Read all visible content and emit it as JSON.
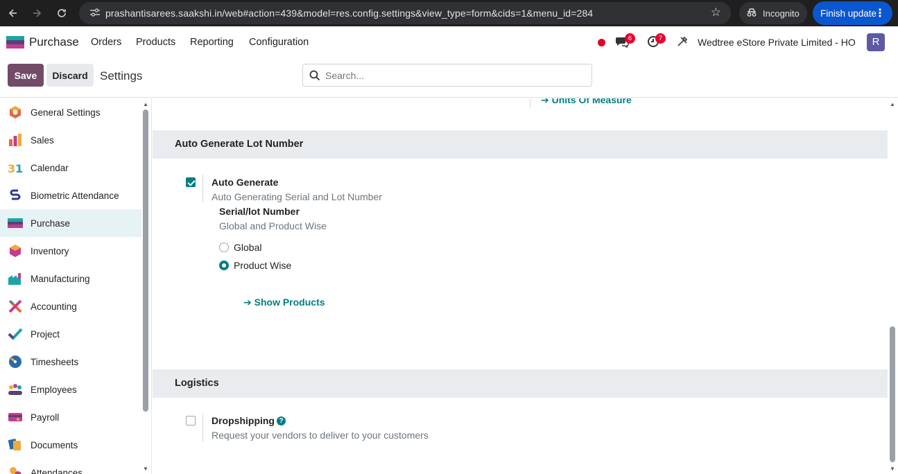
{
  "browser": {
    "url": "prashantisarees.saakshi.in/web#action=439&model=res.config.settings&view_type=form&cids=1&menu_id=284",
    "incognito_label": "Incognito",
    "update_label": "Finish update"
  },
  "navbar": {
    "app_name": "Purchase",
    "menus": [
      "Orders",
      "Products",
      "Reporting",
      "Configuration"
    ],
    "messages_badge": "6",
    "activities_badge": "7",
    "company": "Wedtree eStore Private Limited - HO",
    "avatar_letter": "R"
  },
  "control_panel": {
    "save_label": "Save",
    "discard_label": "Discard",
    "title": "Settings",
    "search_placeholder": "Search..."
  },
  "sidebar": {
    "active": "Purchase",
    "items": [
      {
        "label": "General Settings",
        "icon": "general-settings-icon"
      },
      {
        "label": "Sales",
        "icon": "sales-icon"
      },
      {
        "label": "Calendar",
        "icon": "calendar-icon"
      },
      {
        "label": "Biometric Attendance",
        "icon": "biometric-icon"
      },
      {
        "label": "Purchase",
        "icon": "purchase-icon"
      },
      {
        "label": "Inventory",
        "icon": "inventory-icon"
      },
      {
        "label": "Manufacturing",
        "icon": "manufacturing-icon"
      },
      {
        "label": "Accounting",
        "icon": "accounting-icon"
      },
      {
        "label": "Project",
        "icon": "project-icon"
      },
      {
        "label": "Timesheets",
        "icon": "timesheets-icon"
      },
      {
        "label": "Employees",
        "icon": "employees-icon"
      },
      {
        "label": "Payroll",
        "icon": "payroll-icon"
      },
      {
        "label": "Documents",
        "icon": "documents-icon"
      },
      {
        "label": "Attendances",
        "icon": "attendances-icon"
      }
    ]
  },
  "content": {
    "uom_link": "Units Of Measure",
    "lot_section": {
      "title": "Auto Generate Lot Number",
      "setting_label": "Auto Generate",
      "setting_checked": true,
      "setting_desc": "Auto Generating Serial and Lot Number",
      "sub_label": "Serial/lot Number",
      "sub_desc": "Global and Product Wise",
      "options": [
        "Global",
        "Product Wise"
      ],
      "selected": "Product Wise",
      "link": "Show Products"
    },
    "logistics_section": {
      "title": "Logistics",
      "setting_label": "Dropshipping",
      "setting_checked": false,
      "setting_desc": "Request your vendors to deliver to your customers"
    }
  },
  "colors": {
    "primary": "#714b67",
    "accent": "#017e84",
    "badge": "#e6002e"
  }
}
